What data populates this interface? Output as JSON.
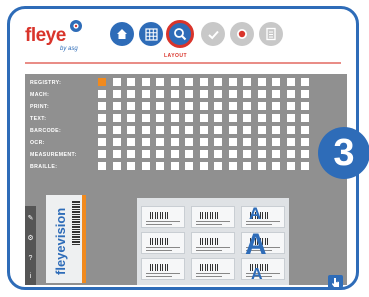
{
  "brand": {
    "logo_text": "fleye",
    "logo_sub": "by asg"
  },
  "nav": {
    "items": [
      {
        "name": "home",
        "icon": "home-icon"
      },
      {
        "name": "grid",
        "icon": "grid-icon"
      },
      {
        "name": "search",
        "icon": "magnifier-icon",
        "active": true
      },
      {
        "name": "check",
        "icon": "check-icon"
      },
      {
        "name": "record",
        "icon": "record-icon"
      },
      {
        "name": "document",
        "icon": "document-icon"
      }
    ],
    "active_label": "LAYOUT"
  },
  "row_labels": [
    "REGISTRY:",
    "MACH:",
    "PRINT:",
    "TEXT:",
    "BARCODE:",
    "OCR:",
    "MEASUREMENT:",
    "BRAILLE:"
  ],
  "preview": {
    "tube_text": "fleyevision",
    "letter": "A"
  },
  "step_number": "3",
  "colors": {
    "primary": "#2e6cb8",
    "accent": "#d9342b",
    "highlight": "#f18a1e"
  }
}
